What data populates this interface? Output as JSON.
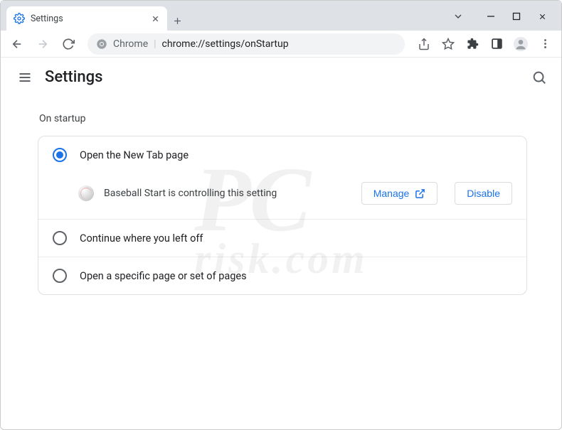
{
  "window": {
    "tab_title": "Settings"
  },
  "omnibox": {
    "host": "Chrome",
    "path": "chrome://settings/onStartup"
  },
  "settings": {
    "title": "Settings",
    "section_label": "On startup",
    "options": {
      "new_tab": "Open the New Tab page",
      "continue": "Continue where you left off",
      "specific": "Open a specific page or set of pages"
    },
    "extension_notice": "Baseball Start is controlling this setting",
    "manage_label": "Manage",
    "disable_label": "Disable"
  },
  "watermark": {
    "main": "PC",
    "sub": "risk.com"
  }
}
